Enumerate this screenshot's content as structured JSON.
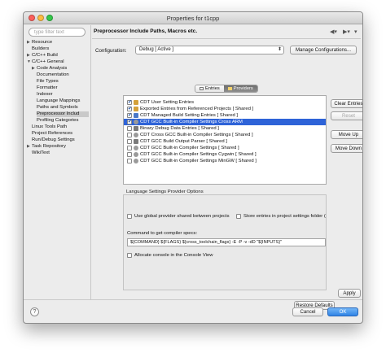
{
  "window": {
    "title": "Properties for t1cpp"
  },
  "sidebar": {
    "filter_placeholder": "type filter text",
    "items": [
      {
        "label": "Resource",
        "arrow": "▶"
      },
      {
        "label": "Builders",
        "arrow": ""
      },
      {
        "label": "C/C++ Build",
        "arrow": "▶"
      },
      {
        "label": "C/C++ General",
        "arrow": "▼"
      },
      {
        "label": "Code Analysis",
        "arrow": "▶"
      },
      {
        "label": "Documentation",
        "arrow": ""
      },
      {
        "label": "File Types",
        "arrow": ""
      },
      {
        "label": "Formatter",
        "arrow": ""
      },
      {
        "label": "Indexer",
        "arrow": ""
      },
      {
        "label": "Language Mappings",
        "arrow": ""
      },
      {
        "label": "Paths and Symbols",
        "arrow": ""
      },
      {
        "label": "Preprocessor Includ",
        "arrow": ""
      },
      {
        "label": "Profiling Categories",
        "arrow": ""
      },
      {
        "label": "Linux Tools Path",
        "arrow": ""
      },
      {
        "label": "Project References",
        "arrow": ""
      },
      {
        "label": "Run/Debug Settings",
        "arrow": ""
      },
      {
        "label": "Task Repository",
        "arrow": "▶"
      },
      {
        "label": "WikiText",
        "arrow": ""
      }
    ]
  },
  "header": {
    "page_title": "Preprocessor Include Paths, Macros etc."
  },
  "configuration": {
    "label": "Configuration:",
    "value": "Debug  [ Active ]",
    "manage_button": "Manage Configurations..."
  },
  "tabs": [
    {
      "label": "Entries"
    },
    {
      "label": "Providers"
    }
  ],
  "providers": [
    {
      "label": "CDT User Setting Entries",
      "checked": "✔",
      "color": "#d4a13a"
    },
    {
      "label": "Exported Entries from Referenced Projects   [ Shared ]",
      "checked": "✔",
      "color": "#d4a13a"
    },
    {
      "label": "CDT Managed Build Setting Entries   [ Shared ]",
      "checked": "✔",
      "color": "#4a78c8"
    },
    {
      "label": "CDT GCC Built-in Compiler Settings Cross ARM",
      "checked": "✔",
      "color": "#9a9a9a"
    },
    {
      "label": "Binary Debug Data Entries   [ Shared ]",
      "checked": "",
      "color": "#7a7a7a"
    },
    {
      "label": "CDT Cross GCC Built-in Compiler Settings   [ Shared ]",
      "checked": "",
      "color": "#9a9a9a"
    },
    {
      "label": "CDT GCC Build Output Parser   [ Shared ]",
      "checked": "",
      "color": "#7a7a7a"
    },
    {
      "label": "CDT GCC Built-in Compiler Settings   [ Shared ]",
      "checked": "",
      "color": "#9a9a9a"
    },
    {
      "label": "CDT GCC Built-in Compiler Settings Cygwin   [ Shared ]",
      "checked": "",
      "color": "#9a9a9a"
    },
    {
      "label": "CDT GCC Built-in Compiler Settings MinGW   [ Shared ]",
      "checked": "",
      "color": "#9a9a9a"
    }
  ],
  "side_buttons": {
    "clear": "Clear Entries",
    "reset": "Reset",
    "move_up": "Move Up",
    "move_down": "Move Down"
  },
  "options": {
    "group_title": "Language Settings Provider Options",
    "global_provider": "Use global provider shared between projects",
    "store_entries": "Store entries in project settings folder (",
    "specs_label": "Command to get compiler specs:",
    "specs_value": "${COMMAND} ${FLAGS} ${cross_toolchain_flags} -E -P -v -dD \"${INPUTS}\"",
    "allocate_console": "Allocate console in the Console View"
  },
  "footer": {
    "restore": "Restore Defaults",
    "apply": "Apply",
    "cancel": "Cancel",
    "ok": "OK",
    "help": "?"
  },
  "colors": {
    "selection": "#2e63d8",
    "primary_button": "#2f84e6"
  },
  "icons": [
    "filter-clear-icon",
    "back-icon",
    "forward-icon",
    "menu-icon",
    "help-icon"
  ]
}
